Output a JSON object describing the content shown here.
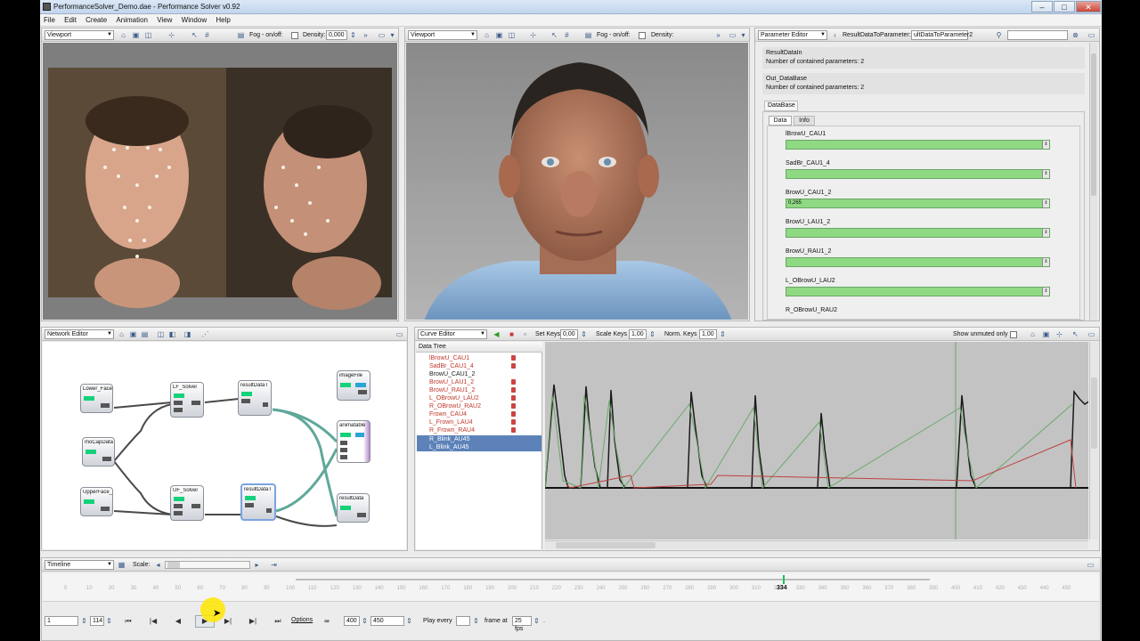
{
  "window": {
    "title": "PerformanceSolver_Demo.dae - Performance Solver v0.92",
    "controls": {
      "minimize": "–",
      "maximize": "□",
      "close": "✕"
    }
  },
  "menu": [
    "File",
    "Edit",
    "Create",
    "Animation",
    "View",
    "Window",
    "Help"
  ],
  "viewport1": {
    "combo": "Viewport",
    "fog_label": "Fog - on/off:",
    "density_label": "Density:",
    "density_value": "0,000"
  },
  "viewport2": {
    "combo": "Viewport",
    "fog_label": "Fog - on/off:",
    "density_label": "Density:"
  },
  "param_editor": {
    "combo": "Parameter Editor",
    "path_label": "ResultDataToParameter:",
    "path_value": "ultDataToParameter2",
    "sections": [
      {
        "name": "ResultDataIn",
        "info": "Number of contained parameters: 2"
      },
      {
        "name": "Out_DataBase",
        "info": "Number of contained parameters: 2"
      }
    ],
    "group": "DataBase",
    "tabs": [
      "Data",
      "Info"
    ],
    "params": [
      {
        "label": "lBrowU_CAU1",
        "value": ""
      },
      {
        "label": "SadBr_CAU1_4",
        "value": ""
      },
      {
        "label": "BrowU_CAU1_2",
        "value": "0,265"
      },
      {
        "label": "BrowU_LAU1_2",
        "value": ""
      },
      {
        "label": "BrowU_RAU1_2",
        "value": ""
      },
      {
        "label": "L_OBrowU_LAU2",
        "value": ""
      },
      {
        "label": "R_OBrowU_RAU2",
        "value": ""
      }
    ]
  },
  "network_editor": {
    "combo": "Network Editor",
    "nodes": [
      {
        "id": "lowerface",
        "label": "Lower_Face"
      },
      {
        "id": "mocapdata",
        "label": "moCapData"
      },
      {
        "id": "upperface",
        "label": "UpperFace_"
      },
      {
        "id": "lfsolver",
        "label": "LF_Solver"
      },
      {
        "id": "ufsolver",
        "label": "UF_Solver"
      },
      {
        "id": "resultdatat1",
        "label": "resultDataT"
      },
      {
        "id": "resultdatat2",
        "label": "resultDataT"
      },
      {
        "id": "imagefile",
        "label": "imageFile"
      },
      {
        "id": "animatable",
        "label": "animatable"
      },
      {
        "id": "resultdata",
        "label": "resultData"
      }
    ]
  },
  "curve_editor": {
    "combo": "Curve Editor",
    "set_keys_label": "Set Keys",
    "set_keys_value": "0,00",
    "scale_keys_label": "Scale Keys",
    "scale_keys_value": "1,00",
    "norm_keys_label": "Norm. Keys",
    "norm_keys_value": "1,00",
    "show_unmuted_label": "Show unmuted only",
    "tree_header": "Data Tree",
    "tree": [
      {
        "label": "lBrowU_CAU1",
        "color": "red",
        "selected": false
      },
      {
        "label": "SadBr_CAU1_4",
        "color": "red",
        "selected": false
      },
      {
        "label": "BrowU_CAU1_2",
        "color": "black",
        "selected": false
      },
      {
        "label": "BrowU_LAU1_2",
        "color": "red",
        "selected": false
      },
      {
        "label": "BrowU_RAU1_2",
        "color": "red",
        "selected": false
      },
      {
        "label": "L_OBrowU_LAU2",
        "color": "red",
        "selected": false
      },
      {
        "label": "R_OBrowU_RAU2",
        "color": "red",
        "selected": false
      },
      {
        "label": "Frown_CAU4",
        "color": "red",
        "selected": false
      },
      {
        "label": "L_Frown_LAU4",
        "color": "red",
        "selected": false
      },
      {
        "label": "R_Frown_RAU4",
        "color": "red",
        "selected": false
      },
      {
        "label": "R_Blink_AU45",
        "color": "white",
        "selected": true
      },
      {
        "label": "L_Blink_AU45",
        "color": "white",
        "selected": true
      }
    ]
  },
  "timeline": {
    "combo": "Timeline",
    "scale_label": "Scale:",
    "current_frame": "334",
    "ticks": [
      "0",
      "10",
      "20",
      "30",
      "40",
      "50",
      "60",
      "70",
      "80",
      "90",
      "100",
      "110",
      "120",
      "130",
      "140",
      "150",
      "160",
      "170",
      "180",
      "190",
      "200",
      "210",
      "220",
      "230",
      "240",
      "250",
      "260",
      "270",
      "280",
      "290",
      "300",
      "310",
      "320",
      "330",
      "340",
      "350",
      "360",
      "370",
      "380",
      "390",
      "400",
      "410",
      "420",
      "430",
      "440",
      "450"
    ],
    "start_value": "1",
    "end_value": "114",
    "options_label": "Options",
    "range_start": "400",
    "range_end": "450",
    "play_every_label": "Play every",
    "play_every_value": "",
    "frame_at_label": "frame at",
    "fps_value": "25 fps",
    "fps_suffix": "."
  },
  "colors": {
    "accent_green": "#14d27a",
    "param_bar": "#8fd983",
    "selection": "#5c82b9"
  }
}
